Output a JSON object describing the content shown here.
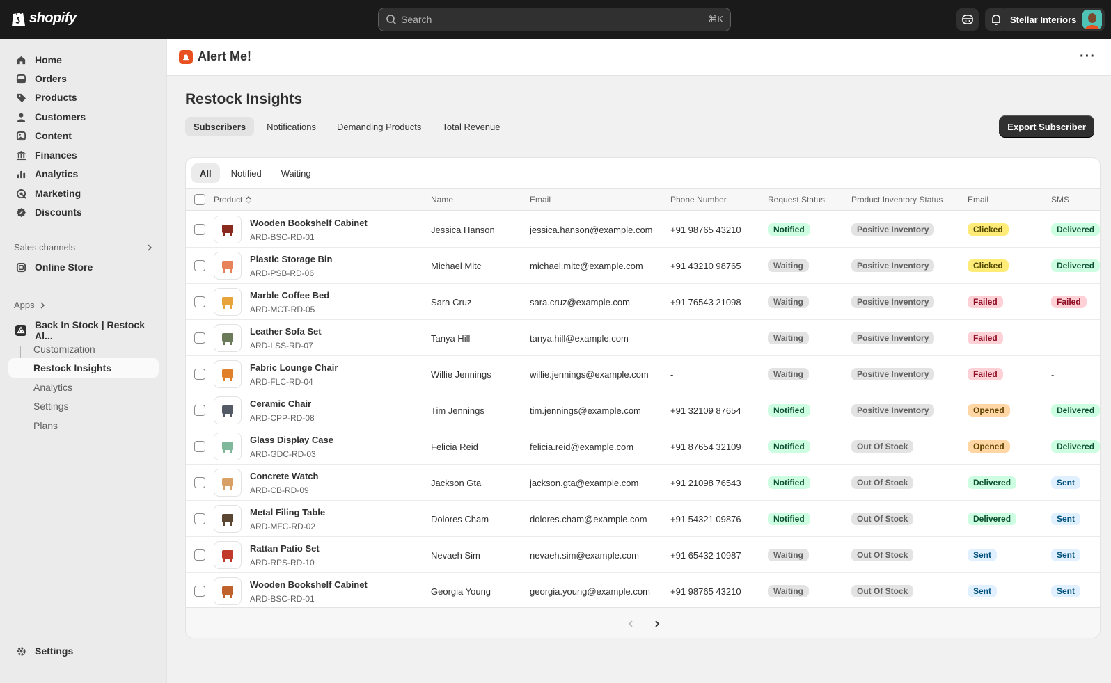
{
  "topbar": {
    "brand": "shopify",
    "search_placeholder": "Search",
    "search_shortcut": "⌘K",
    "store_name": "Stellar Interiors"
  },
  "sidebar": {
    "items": [
      {
        "label": "Home",
        "icon": "home-icon"
      },
      {
        "label": "Orders",
        "icon": "orders-icon"
      },
      {
        "label": "Products",
        "icon": "tag-icon"
      },
      {
        "label": "Customers",
        "icon": "person-icon"
      },
      {
        "label": "Content",
        "icon": "content-icon"
      },
      {
        "label": "Finances",
        "icon": "bank-icon"
      },
      {
        "label": "Analytics",
        "icon": "bar-chart-icon"
      },
      {
        "label": "Marketing",
        "icon": "target-icon"
      },
      {
        "label": "Discounts",
        "icon": "discount-icon"
      }
    ],
    "sales_channels_label": "Sales channels",
    "online_store": "Online Store",
    "apps_label": "Apps",
    "app_name": "Back In Stock | Restock Al...",
    "app_sub_items": [
      "Customization",
      "Restock Insights",
      "Analytics",
      "Settings",
      "Plans"
    ],
    "settings": "Settings"
  },
  "app_header": {
    "title": "Alert Me!"
  },
  "page": {
    "title": "Restock Insights",
    "tabs": [
      "Subscribers",
      "Notifications",
      "Demanding Products",
      "Total Revenue"
    ],
    "export_button": "Export Subscriber",
    "filters": [
      "All",
      "Notified",
      "Waiting"
    ]
  },
  "table": {
    "columns": [
      "Product",
      "Name",
      "Email",
      "Phone Number",
      "Request Status",
      "Product Inventory Status",
      "Email",
      "SMS"
    ],
    "rows": [
      {
        "product": "Wooden Bookshelf Cabinet",
        "sku": "ARD-BSC-RD-01",
        "name": "Jessica Hanson",
        "email": "jessica.hanson@example.com",
        "phone": "+91 98765 43210",
        "request": "Notified",
        "inventory": "Positive Inventory",
        "email_status": "Clicked",
        "sms": "Delivered"
      },
      {
        "product": "Plastic Storage Bin",
        "sku": "ARD-PSB-RD-06",
        "name": "Michael Mitc",
        "email": "michael.mitc@example.com",
        "phone": "+91 43210 98765",
        "request": "Waiting",
        "inventory": "Positive Inventory",
        "email_status": "Clicked",
        "sms": "Delivered"
      },
      {
        "product": "Marble Coffee Bed",
        "sku": "ARD-MCT-RD-05",
        "name": "Sara Cruz",
        "email": "sara.cruz@example.com",
        "phone": "+91 76543 21098",
        "request": "Waiting",
        "inventory": "Positive Inventory",
        "email_status": "Failed",
        "sms": "Failed"
      },
      {
        "product": "Leather Sofa Set",
        "sku": "ARD-LSS-RD-07",
        "name": "Tanya Hill",
        "email": "tanya.hill@example.com",
        "phone": "-",
        "request": "Waiting",
        "inventory": "Positive Inventory",
        "email_status": "Failed",
        "sms": "-"
      },
      {
        "product": "Fabric Lounge Chair",
        "sku": "ARD-FLC-RD-04",
        "name": "Willie Jennings",
        "email": "willie.jennings@example.com",
        "phone": "-",
        "request": "Waiting",
        "inventory": "Positive Inventory",
        "email_status": "Failed",
        "sms": "-"
      },
      {
        "product": "Ceramic Chair",
        "sku": "ARD-CPP-RD-08",
        "name": "Tim Jennings",
        "email": "tim.jennings@example.com",
        "phone": "+91 32109 87654",
        "request": "Notified",
        "inventory": "Positive Inventory",
        "email_status": "Opened",
        "sms": "Delivered"
      },
      {
        "product": "Glass Display Case",
        "sku": "ARD-GDC-RD-03",
        "name": "Felicia Reid",
        "email": "felicia.reid@example.com",
        "phone": "+91 87654 32109",
        "request": "Notified",
        "inventory": "Out Of Stock",
        "email_status": "Opened",
        "sms": "Delivered"
      },
      {
        "product": "Concrete Watch",
        "sku": "ARD-CB-RD-09",
        "name": "Jackson Gta",
        "email": "jackson.gta@example.com",
        "phone": "+91 21098 76543",
        "request": "Notified",
        "inventory": "Out Of Stock",
        "email_status": "Delivered",
        "sms": "Sent"
      },
      {
        "product": "Metal Filing Table",
        "sku": "ARD-MFC-RD-02",
        "name": "Dolores Cham",
        "email": "dolores.cham@example.com",
        "phone": "+91 54321 09876",
        "request": "Notified",
        "inventory": "Out Of Stock",
        "email_status": "Delivered",
        "sms": "Sent"
      },
      {
        "product": "Rattan Patio Set",
        "sku": "ARD-RPS-RD-10",
        "name": "Nevaeh Sim",
        "email": "nevaeh.sim@example.com",
        "phone": "+91 65432 10987",
        "request": "Waiting",
        "inventory": "Out Of Stock",
        "email_status": "Sent",
        "sms": "Sent"
      },
      {
        "product": "Wooden Bookshelf Cabinet",
        "sku": "ARD-BSC-RD-01",
        "name": "Georgia Young",
        "email": "georgia.young@example.com",
        "phone": "+91 98765 43210",
        "request": "Waiting",
        "inventory": "Out Of Stock",
        "email_status": "Sent",
        "sms": "Sent"
      }
    ]
  },
  "colors": {
    "topbar": "#1a1a1a",
    "accent_app_icon": "#e8501f",
    "primary_button": "#303030"
  }
}
